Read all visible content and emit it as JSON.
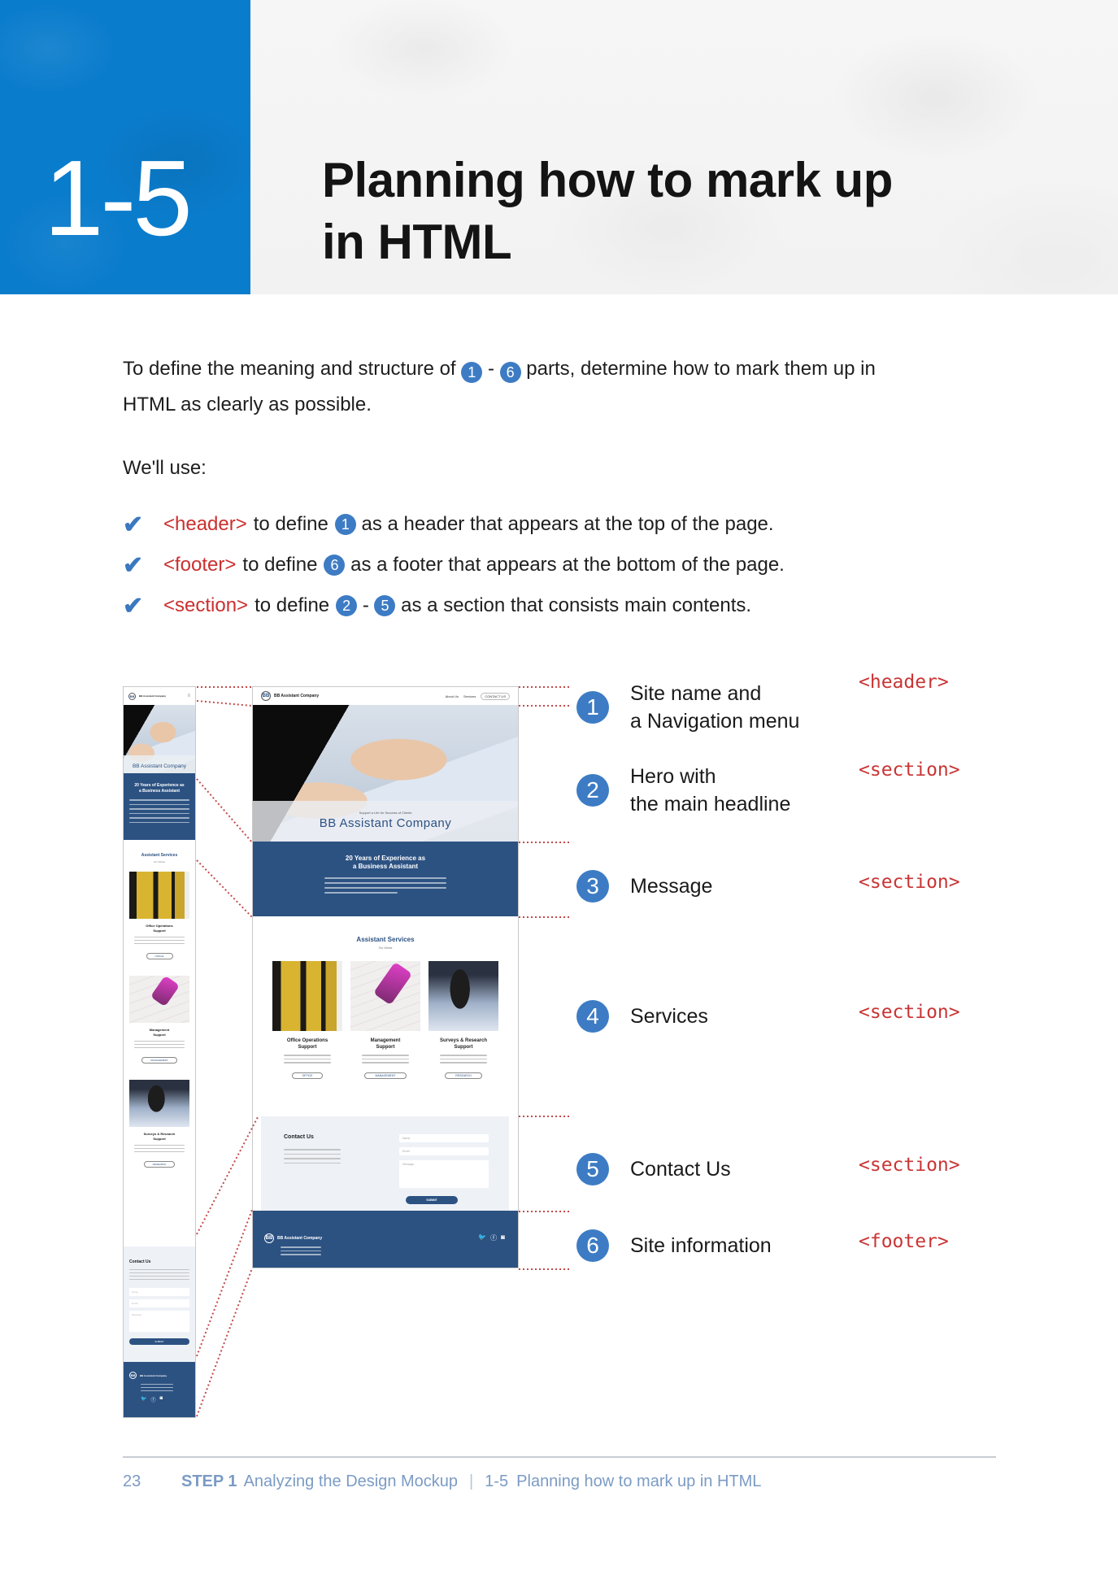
{
  "banner": {
    "chapter_number": "1-5",
    "title_line1": "Planning how to mark up",
    "title_line2": "in HTML",
    "accent_color": "#0a7ccc"
  },
  "intro": {
    "before": "To define the meaning and structure of",
    "badge_start": "1",
    "dash": "-",
    "badge_end": "6",
    "after": "parts, determine how to mark them up in HTML as clearly as possible."
  },
  "we_use": "We'll use:",
  "checklist": [
    {
      "icon": "check-icon",
      "tag": "<header>",
      "to_define": "to define",
      "badges": [
        "1"
      ],
      "desc": "as a header that appears at the top of the page."
    },
    {
      "icon": "check-icon",
      "tag": "<footer>",
      "to_define": "to define",
      "badges": [
        "6"
      ],
      "desc": "as a footer that appears at the bottom of the page."
    },
    {
      "icon": "check-icon",
      "tag": "<section>",
      "to_define": "to define",
      "badges": [
        "2",
        "5"
      ],
      "desc": "as a section that consists main contents."
    }
  ],
  "legend": [
    {
      "num": "1",
      "label_line1": "Site name and",
      "label_line2": "a Navigation menu",
      "tag": "<header>"
    },
    {
      "num": "2",
      "label_line1": "Hero with",
      "label_line2": "the main headline",
      "tag": "<section>"
    },
    {
      "num": "3",
      "label_line1": "Message",
      "label_line2": "",
      "tag": "<section>"
    },
    {
      "num": "4",
      "label_line1": "Services",
      "label_line2": "",
      "tag": "<section>"
    },
    {
      "num": "5",
      "label_line1": "Contact Us",
      "label_line2": "",
      "tag": "<section>"
    },
    {
      "num": "6",
      "label_line1": "Site information",
      "label_line2": "",
      "tag": "<footer>"
    }
  ],
  "mockup": {
    "logo": "BB",
    "site_name": "BB Assistant Company",
    "nav": [
      "About Us",
      "Services",
      "CONTACT US"
    ],
    "menu_icon": "hamburger-icon",
    "hero_sub": "Support a Life for Success of Clients",
    "hero_title": "BB Assistant Company",
    "message_title_line1": "20 Years of Experience as",
    "message_title_line2": "a Business Assistant",
    "services_title": "Assistant Services",
    "services_sub": "Our Works",
    "services": [
      {
        "name_line1": "Office Operations",
        "name_line2": "Support",
        "button": "OFFICE"
      },
      {
        "name_line1": "Management",
        "name_line2": "Support",
        "button": "MANAGEMENT"
      },
      {
        "name_line1": "Surveys & Research",
        "name_line2": "Support",
        "button": "RESEARCH"
      }
    ],
    "contact_title": "Contact Us",
    "contact_fields": [
      "Name",
      "Email",
      "Message"
    ],
    "submit_label": "SUBMIT",
    "social_icons": [
      "twitter-icon",
      "facebook-icon",
      "instagram-icon"
    ],
    "brand_color": "#2c5282"
  },
  "page_footer": {
    "page_number": "23",
    "step": "STEP 1",
    "step_title": "Analyzing the Design Mockup",
    "separator": "|",
    "section_number": "1-5",
    "section_title": "Planning how to mark up in HTML"
  }
}
